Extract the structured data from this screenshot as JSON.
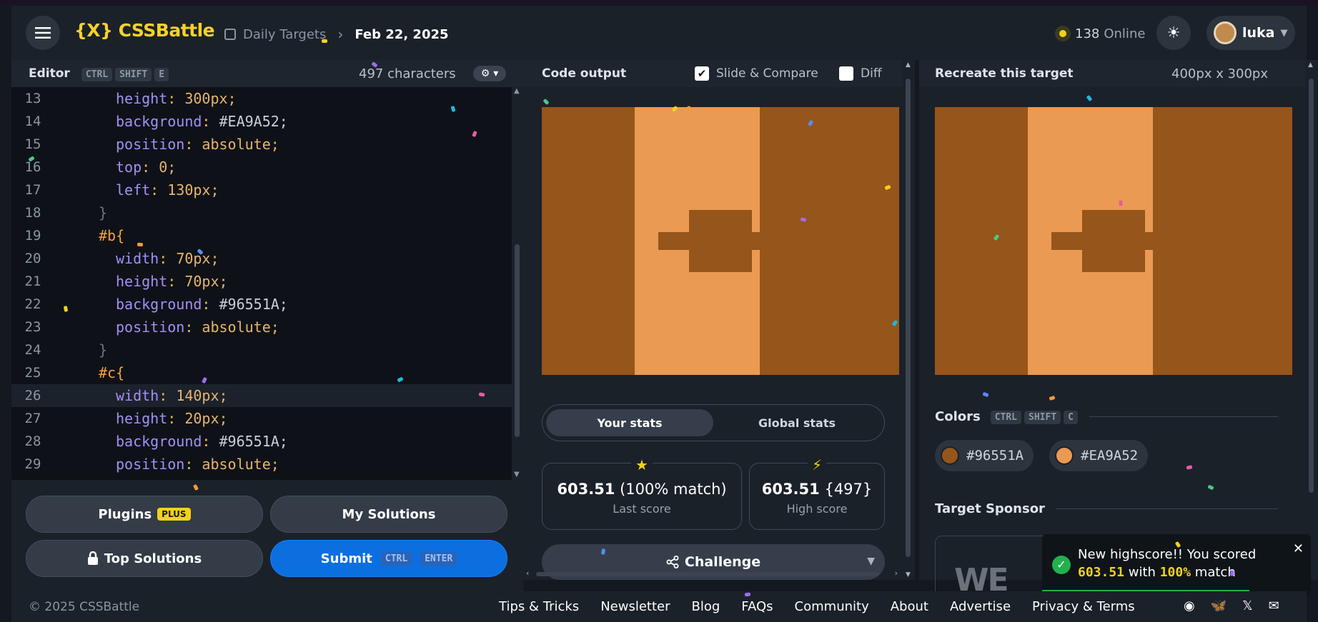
{
  "header": {
    "logo": "{X} CSSBattle",
    "breadcrumb_section": "Daily Targets",
    "breadcrumb_date": "Feb 22, 2025",
    "online_count": "138",
    "online_label": "Online",
    "user_name": "luka"
  },
  "editor": {
    "title": "Editor",
    "shortcut": [
      "CTRL",
      "SHIFT",
      "E"
    ],
    "char_count": "497 characters",
    "lines": [
      {
        "n": "13",
        "text": "height: 300px;"
      },
      {
        "n": "14",
        "text": "background: #EA9A52;"
      },
      {
        "n": "15",
        "text": "position: absolute;"
      },
      {
        "n": "16",
        "text": "top: 0;"
      },
      {
        "n": "17",
        "text": "left: 130px;"
      },
      {
        "n": "18",
        "text": "}"
      },
      {
        "n": "19",
        "text": "#b{"
      },
      {
        "n": "20",
        "text": "width: 70px;"
      },
      {
        "n": "21",
        "text": "height: 70px;"
      },
      {
        "n": "22",
        "text": "background: #96551A;"
      },
      {
        "n": "23",
        "text": "position: absolute;"
      },
      {
        "n": "24",
        "text": "}"
      },
      {
        "n": "25",
        "text": "#c{"
      },
      {
        "n": "26",
        "text": "width: 140px;"
      },
      {
        "n": "27",
        "text": "height: 20px;"
      },
      {
        "n": "28",
        "text": "background: #96551A;"
      },
      {
        "n": "29",
        "text": "position: absolute;"
      }
    ],
    "active_line": "26",
    "buttons": {
      "plugins": "Plugins",
      "plugins_badge": "PLUS",
      "my_solutions": "My Solutions",
      "top_solutions": "Top Solutions",
      "submit": "Submit",
      "submit_keys": [
        "CTRL",
        "ENTER"
      ]
    }
  },
  "output": {
    "title": "Code output",
    "slide_compare_label": "Slide & Compare",
    "slide_compare_checked": true,
    "diff_label": "Diff",
    "diff_checked": false,
    "tabs": [
      "Your stats",
      "Global stats"
    ],
    "active_tab": "Your stats",
    "last_score": "603.51",
    "last_match": "(100% match)",
    "last_score_label": "Last score",
    "high_score": "603.51",
    "high_chars": "{497}",
    "high_score_label": "High score",
    "challenge_label": "Challenge"
  },
  "target": {
    "title": "Recreate this target",
    "size": "400px x 300px",
    "colors_label": "Colors",
    "colors_shortcut": [
      "CTRL",
      "SHIFT",
      "C"
    ],
    "colors": [
      {
        "hex": "#96551A"
      },
      {
        "hex": "#EA9A52"
      }
    ],
    "sponsor_label": "Target Sponsor",
    "sponsor_text": "WE"
  },
  "toast": {
    "line1": "New highscore!! You scored",
    "score": "603.51",
    "with": "with",
    "match": "100%",
    "match_suffix": "match"
  },
  "footer": {
    "copyright": "© 2025 CSSBattle",
    "links": [
      "Tips & Tricks",
      "Newsletter",
      "Blog",
      "FAQs",
      "Community",
      "About",
      "Advertise",
      "Privacy & Terms"
    ]
  },
  "colors": {
    "dark": "#96551A",
    "light": "#EA9A52",
    "accent": "#f2d21b",
    "submit_blue": "#0b6fe0"
  }
}
